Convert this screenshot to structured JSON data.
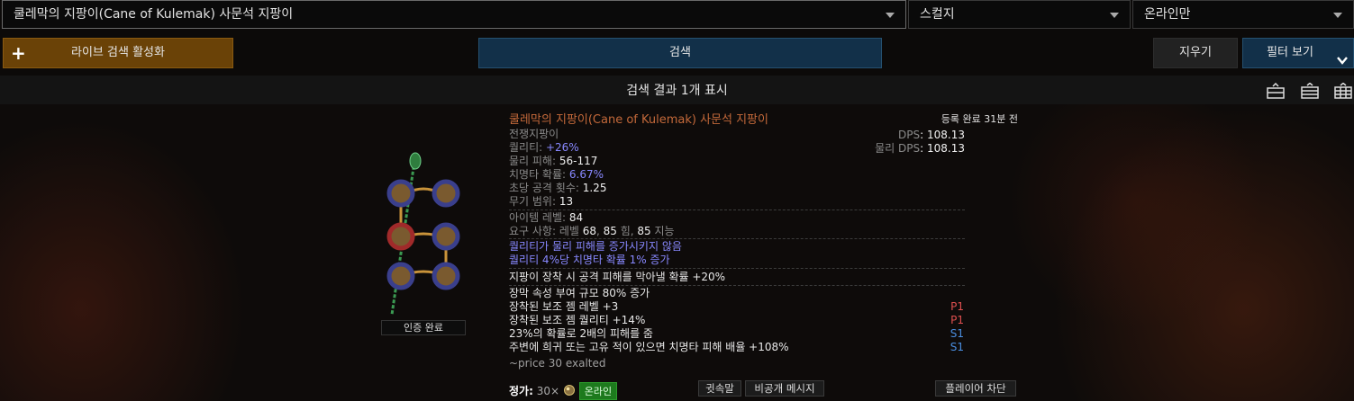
{
  "search_bar": {
    "item_value": "쿨레막의 지팡이(Cane of Kulemak) 사문석 지팡이",
    "league_value": "스컬지",
    "status_value": "온라인만"
  },
  "toolbar": {
    "live_label": "라이브 검색 활성화",
    "search_label": "검색",
    "clear_label": "지우기",
    "filter_label": "필터 보기"
  },
  "results": {
    "count_label": "검색 결과 1개 표시"
  },
  "item": {
    "name": "쿨레막의 지팡이(Cane of Kulemak) 사문석 지팡이",
    "listed": "등록 완료 31분 전",
    "verified": "인증 완료",
    "type": "전쟁지팡이",
    "quality_label": "퀄리티: ",
    "quality_value": "+26%",
    "phys_label": "물리 피해: ",
    "phys_value": "56-117",
    "crit_label": "치명타 확률: ",
    "crit_value": "6.67%",
    "aps_label": "초당 공격 횟수: ",
    "aps_value": "1.25",
    "range_label": "무기 범위: ",
    "range_value": "13",
    "dps_label": "DPS",
    "dps_value": ": 108.13",
    "pdps_label": "물리 DPS",
    "pdps_value": ": 108.13",
    "ilvl_label": "아이템 레벨: ",
    "ilvl_value": "84",
    "req_label": "요구 사항: 레벨 ",
    "req_level": "68",
    "req_sep1": ", ",
    "req_str": "85",
    "req_str_label": " 힘, ",
    "req_int": "85",
    "req_int_label": " 지능",
    "enchant_1": "퀄리티가 물리 피해를 증가시키지 않음",
    "enchant_2": "퀄리티 4%당 치명타 확률 1% 증가",
    "implicit": "지팡이 장착 시 공격 피해를 막아낼 확률 +20%",
    "mods": [
      {
        "text": "장막 속성 부여 규모 80% 증가",
        "tag": ""
      },
      {
        "text": "장착된 보조 젬 레벨 +3",
        "tag": "P1"
      },
      {
        "text": "장착된 보조 젬 퀄리티 +14%",
        "tag": "P1"
      },
      {
        "text": "23%의 확률로 2배의 피해를 줌",
        "tag": "S1"
      },
      {
        "text": "주변에 희귀 또는 고유 적이 있으면 치명타 피해 배율 +108%",
        "tag": "S1"
      }
    ],
    "note": "~price 30 exalted",
    "price_label": "정가:",
    "price_value": "30×",
    "online_label": "온라인",
    "whisper_label": "귓속말",
    "private_msg_label": "비공개 메시지",
    "block_label": "플레이어 차단"
  },
  "colors": {
    "unique": "#c4693a",
    "magic": "#8888ff",
    "prefix": "#e05050",
    "suffix": "#4a8ee0",
    "accent": "#123049",
    "live": "#6a4207",
    "online": "#1d7a1d"
  }
}
